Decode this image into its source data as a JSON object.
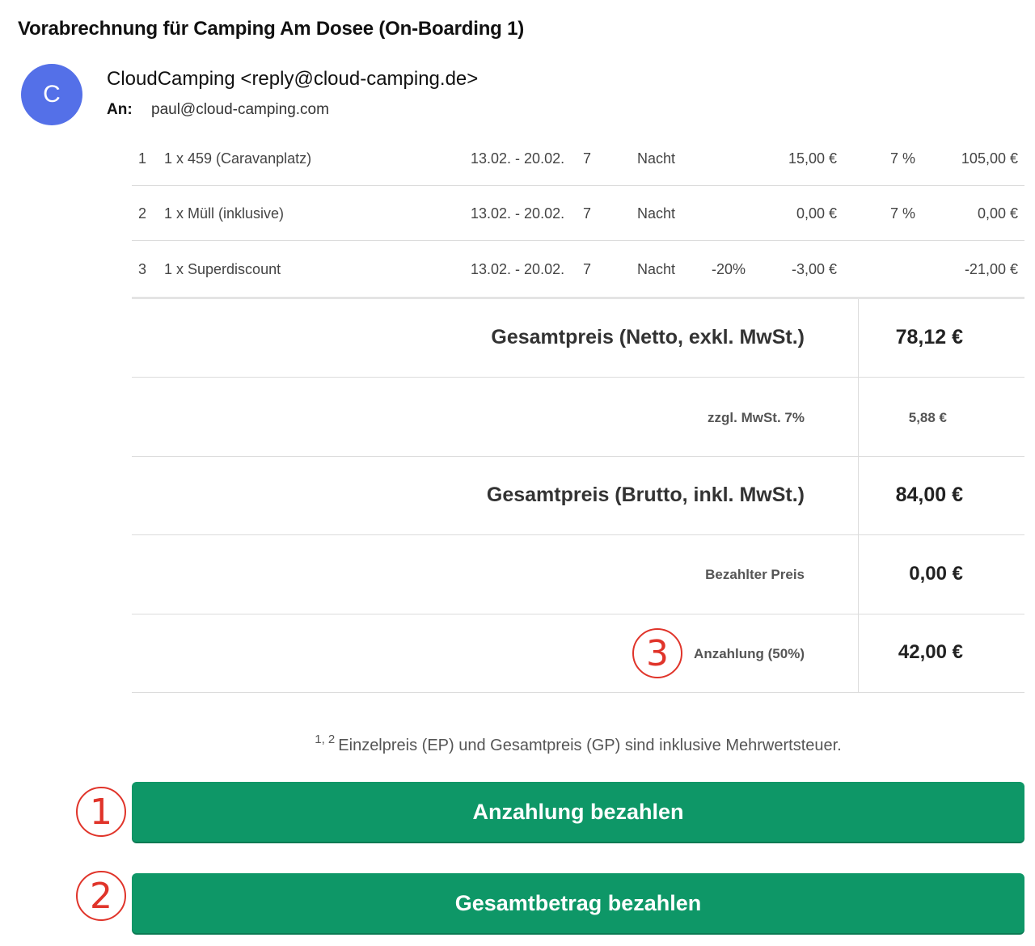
{
  "email": {
    "subject": "Vorabrechnung für Camping Am Dosee (On-Boarding 1)",
    "avatar_letter": "C",
    "sender": "CloudCamping <reply@cloud-camping.de>",
    "to_label": "An:",
    "to_value": "paul@cloud-camping.com"
  },
  "items": [
    {
      "no": "1",
      "desc": "1 x 459 (Caravanplatz)",
      "date": "13.02. - 20.02.",
      "qty": "7",
      "unit": "Nacht",
      "discount": "",
      "ep": "15,00 €",
      "tax": "7 %",
      "gp": "105,00 €"
    },
    {
      "no": "2",
      "desc": "1 x Müll (inklusive)",
      "date": "13.02. - 20.02.",
      "qty": "7",
      "unit": "Nacht",
      "discount": "",
      "ep": "0,00 €",
      "tax": "7 %",
      "gp": "0,00 €"
    },
    {
      "no": "3",
      "desc": "1 x Superdiscount",
      "date": "13.02. - 20.02.",
      "qty": "7",
      "unit": "Nacht",
      "discount": "-20%",
      "ep": "-3,00 €",
      "tax": "",
      "gp": "-21,00 €"
    }
  ],
  "summary": {
    "netto_label": "Gesamtpreis (Netto, exkl. MwSt.)",
    "netto_value": "78,12 €",
    "mwst_label": "zzgl. MwSt. 7%",
    "mwst_value": "5,88 €",
    "brutto_label": "Gesamtpreis (Brutto, inkl. MwSt.)",
    "brutto_value": "84,00 €",
    "paid_label": "Bezahlter Preis",
    "paid_value": "0,00 €",
    "deposit_label": "Anzahlung (50%)",
    "deposit_value": "42,00 €"
  },
  "footnote": {
    "sup": "1, 2",
    "text": "Einzelpreis (EP) und Gesamtpreis (GP) sind inklusive Mehrwertsteuer."
  },
  "buttons": {
    "deposit": "Anzahlung bezahlen",
    "total": "Gesamtbetrag bezahlen"
  },
  "markers": {
    "one": "1",
    "two": "2",
    "three": "3"
  },
  "colors": {
    "avatar": "#5470e8",
    "button": "#0e9767",
    "marker": "#e0342a"
  }
}
